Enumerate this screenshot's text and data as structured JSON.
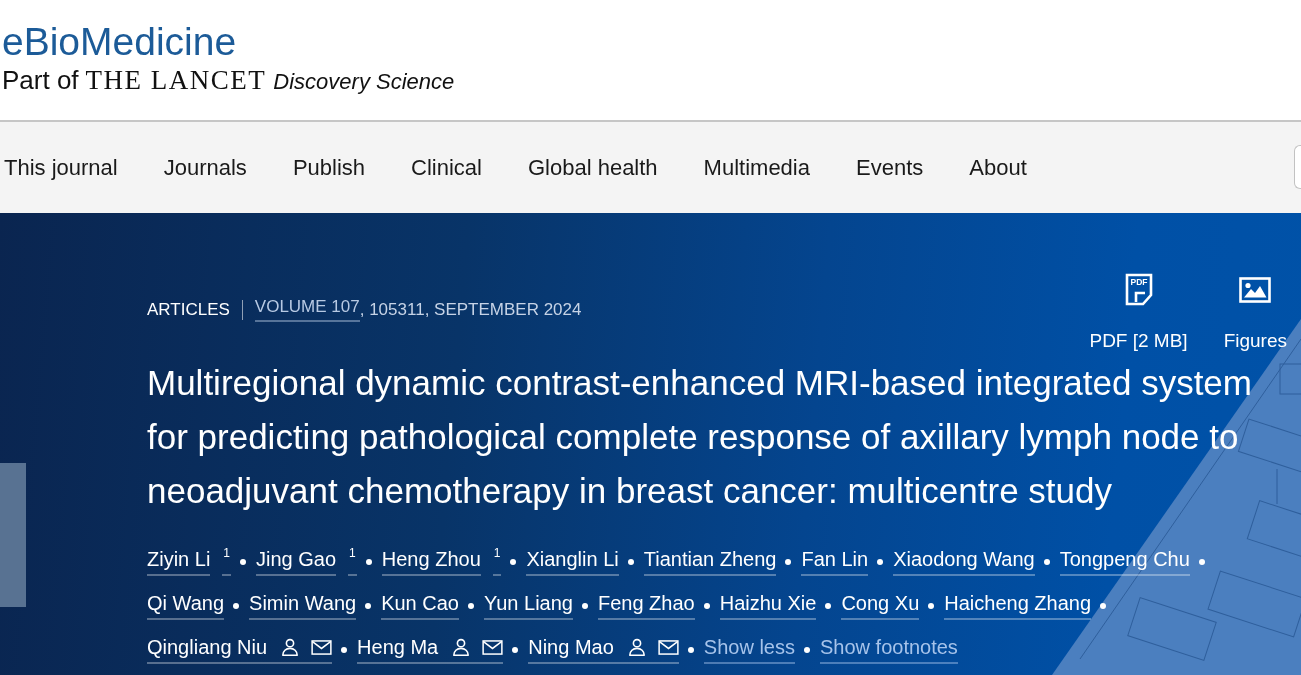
{
  "header": {
    "journal": "eBioMedicine",
    "tagline": {
      "prefix": "Part of",
      "brand": "THE LANCET",
      "suffix": "Discovery Science"
    }
  },
  "nav": {
    "items": [
      "This journal",
      "Journals",
      "Publish",
      "Clinical",
      "Global health",
      "Multimedia",
      "Events",
      "About"
    ]
  },
  "article": {
    "meta": {
      "category": "ARTICLES",
      "volume": "VOLUME 107",
      "details": ", 105311, SEPTEMBER 2024"
    },
    "tools": [
      {
        "kind": "pdf",
        "icon_text": "PDF",
        "label": "PDF [2 MB]"
      },
      {
        "kind": "figures",
        "label": "Figures"
      }
    ],
    "title_lines": [
      "Multiregional dynamic contrast-enhanced MRI-based integrated system",
      "for predicting pathological complete response of axillary lymph node to",
      "neoadjuvant chemotherapy in breast cancer: multicentre study"
    ],
    "authors": [
      {
        "name": "Ziyin Li",
        "footnote": "1",
        "corresponding": false
      },
      {
        "name": "Jing Gao",
        "footnote": "1",
        "corresponding": false
      },
      {
        "name": "Heng Zhou",
        "footnote": "1",
        "corresponding": false
      },
      {
        "name": "Xianglin Li",
        "corresponding": false
      },
      {
        "name": "Tiantian Zheng",
        "corresponding": false
      },
      {
        "name": "Fan Lin",
        "corresponding": false
      },
      {
        "name": "Xiaodong Wang",
        "corresponding": false
      },
      {
        "name": "Tongpeng Chu",
        "corresponding": false
      },
      {
        "name": "Qi Wang",
        "corresponding": false
      },
      {
        "name": "Simin Wang",
        "corresponding": false
      },
      {
        "name": "Kun Cao",
        "corresponding": false
      },
      {
        "name": "Yun Liang",
        "corresponding": false
      },
      {
        "name": "Feng Zhao",
        "corresponding": false
      },
      {
        "name": "Haizhu Xie",
        "corresponding": false
      },
      {
        "name": "Cong Xu",
        "corresponding": false
      },
      {
        "name": "Haicheng Zhang",
        "corresponding": false
      },
      {
        "name": "Qingliang Niu",
        "corresponding": true
      },
      {
        "name": "Heng Ma",
        "corresponding": true
      },
      {
        "name": "Ning Mao",
        "corresponding": true
      }
    ],
    "links": [
      {
        "label": "Show less"
      },
      {
        "label": "Show footnotes"
      }
    ]
  }
}
